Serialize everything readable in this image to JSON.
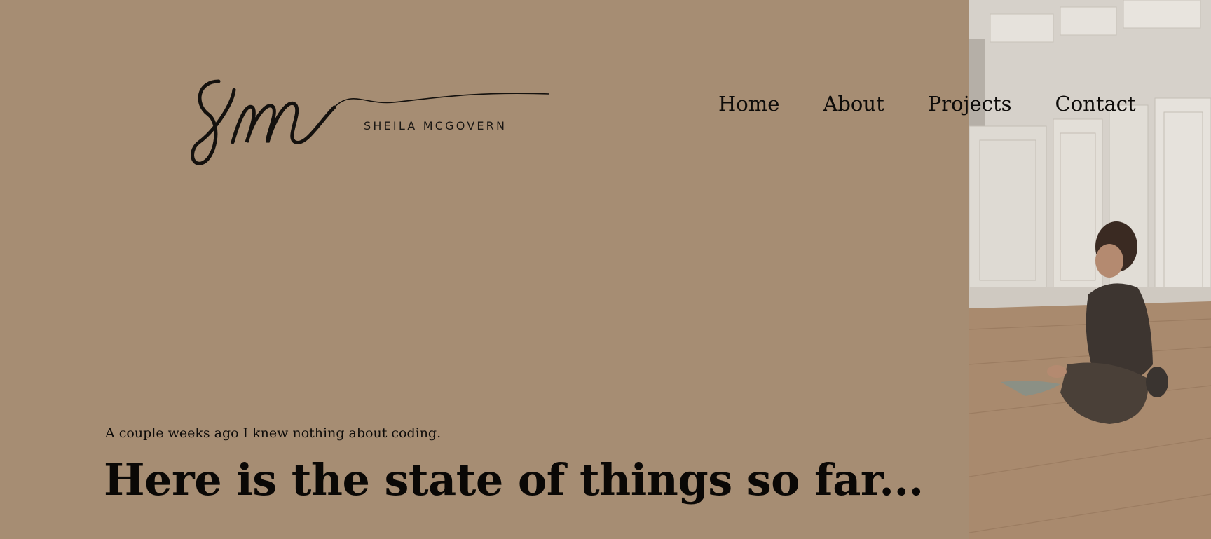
{
  "brand": {
    "initials": "sm",
    "name": "SHEILA MCGOVERN"
  },
  "nav": {
    "items": [
      {
        "label": "Home"
      },
      {
        "label": "About"
      },
      {
        "label": "Projects"
      },
      {
        "label": "Contact"
      }
    ]
  },
  "hero": {
    "intro": "A couple weeks ago I knew nothing about coding.",
    "headline": "Here is the state of things so far..."
  },
  "colors": {
    "background": "#a68d73",
    "text": "#0d0b09"
  }
}
